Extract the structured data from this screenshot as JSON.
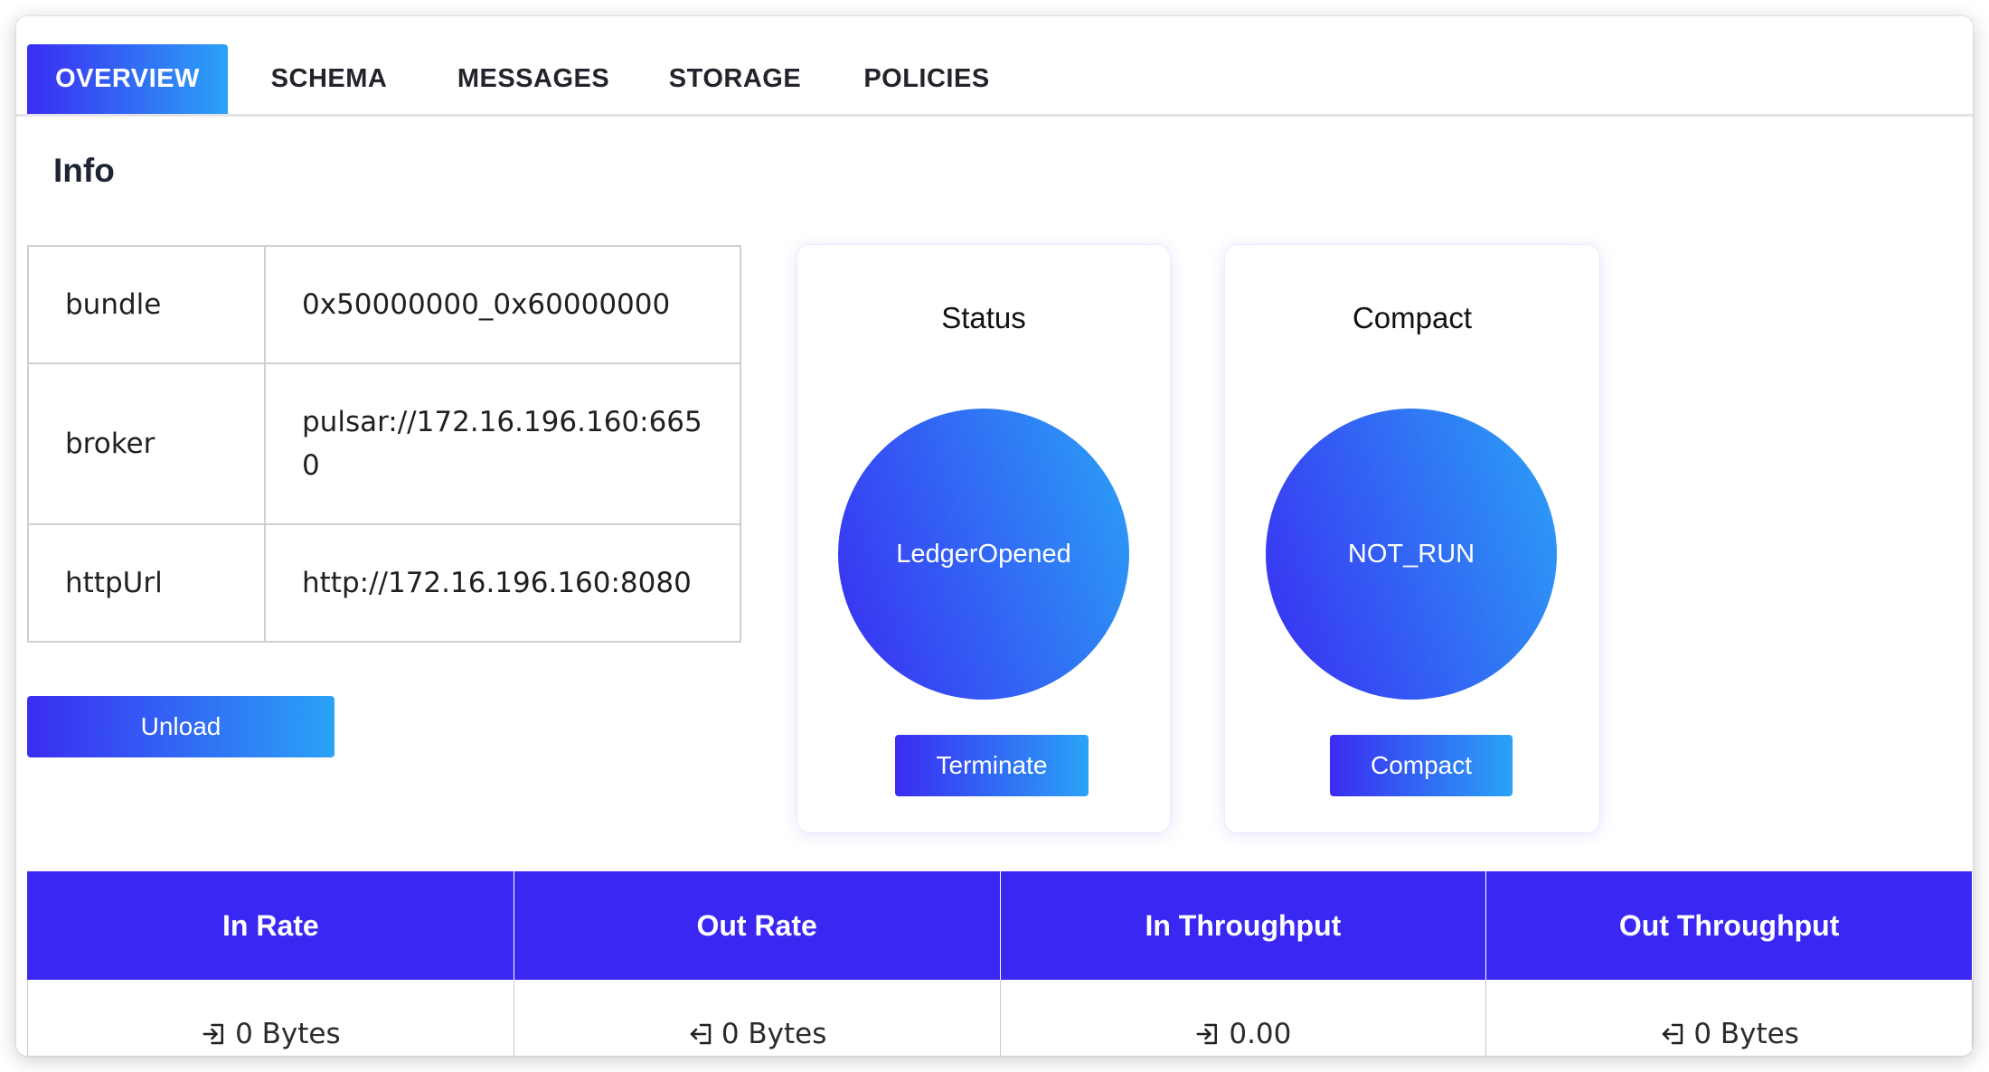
{
  "tabs": [
    {
      "label": "OVERVIEW",
      "active": true
    },
    {
      "label": "SCHEMA",
      "active": false
    },
    {
      "label": "MESSAGES",
      "active": false
    },
    {
      "label": "STORAGE",
      "active": false
    },
    {
      "label": "POLICIES",
      "active": false
    }
  ],
  "info": {
    "heading": "Info",
    "rows": [
      {
        "key": "bundle",
        "value": "0x50000000_0x60000000"
      },
      {
        "key": "broker",
        "value": "pulsar://172.16.196.160:6650"
      },
      {
        "key": "httpUrl",
        "value": "http://172.16.196.160:8080"
      }
    ],
    "unload_label": "Unload"
  },
  "status_card": {
    "title": "Status",
    "value": "LedgerOpened",
    "button_label": "Terminate"
  },
  "compact_card": {
    "title": "Compact",
    "value": "NOT_RUN",
    "button_label": "Compact"
  },
  "stats": {
    "headers": [
      "In Rate",
      "Out Rate",
      "In Throughput",
      "Out Throughput"
    ],
    "values": [
      {
        "icon": "sign-in-icon",
        "text": "0 Bytes"
      },
      {
        "icon": "sign-out-icon",
        "text": "0 Bytes"
      },
      {
        "icon": "sign-in-icon",
        "text": "0.00"
      },
      {
        "icon": "sign-out-icon",
        "text": "0 Bytes"
      }
    ]
  },
  "colors": {
    "accent_start": "#3a2cf2",
    "accent_end": "#2aa3f6",
    "header_bg": "#3a28f2"
  }
}
